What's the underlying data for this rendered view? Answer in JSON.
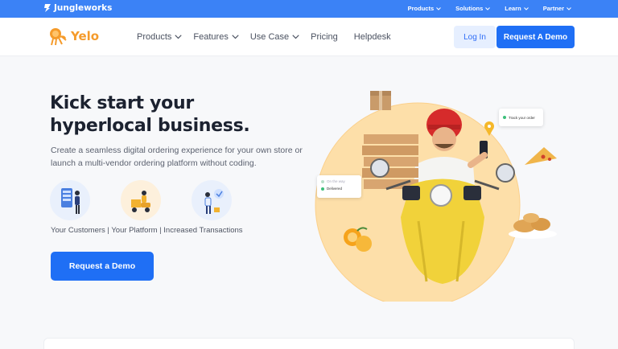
{
  "topbar": {
    "brand": "Jungleworks",
    "menu": [
      {
        "label": "Products"
      },
      {
        "label": "Solutions"
      },
      {
        "label": "Learn"
      },
      {
        "label": "Partner"
      }
    ]
  },
  "nav": {
    "logo": "Yelo",
    "links": [
      {
        "label": "Products",
        "dropdown": true
      },
      {
        "label": "Features",
        "dropdown": true
      },
      {
        "label": "Use Case",
        "dropdown": true
      },
      {
        "label": "Pricing",
        "dropdown": false
      },
      {
        "label": "Helpdesk",
        "dropdown": false
      }
    ],
    "login_label": "Log In",
    "demo_label": "Request A Demo"
  },
  "hero": {
    "title_line1": "Kick start your",
    "title_line2": "hyperlocal business.",
    "subtitle": "Create a seamless digital ordering experience for your own store or launch a multi-vendor ordering platform without coding.",
    "features_text": "Your Customers | Your Platform | Increased Transactions",
    "cta_label": "Request a Demo"
  },
  "illustration": {
    "track_card": "Track your order",
    "status_card": {
      "row1": "On the way",
      "row2": "Delivered"
    }
  },
  "colors": {
    "topbar": "#3b82f6",
    "primary": "#1f6ff5",
    "brand_orange": "#f59b2b",
    "hero_circle": "#fddfa9"
  }
}
